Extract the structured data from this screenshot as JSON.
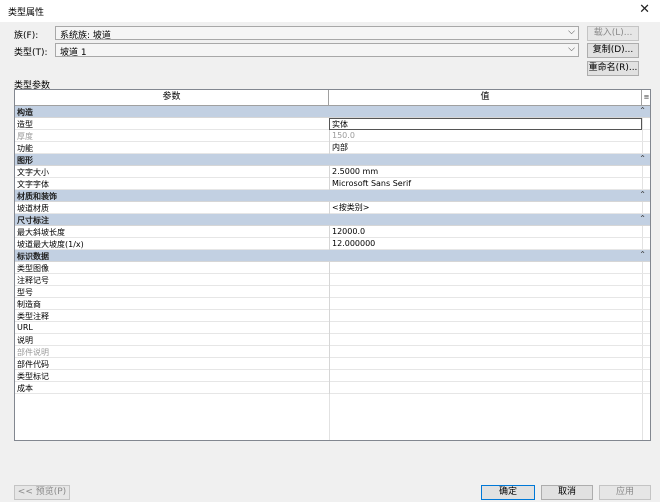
{
  "window": {
    "title": "类型属性",
    "close_glyph": "✕"
  },
  "family": {
    "label": "族(F):",
    "value": "系统族: 坡道"
  },
  "type": {
    "label": "类型(T):",
    "value": "坡道 1"
  },
  "buttons": {
    "load": "载入(L)...",
    "duplicate": "复制(D)...",
    "rename": "重命名(R)...",
    "preview": "<< 预览(P)",
    "ok": "确定",
    "cancel": "取消",
    "apply": "应用"
  },
  "section_label": "类型参数",
  "grid": {
    "headers": {
      "param": "参数",
      "value": "值",
      "toggle": "≡"
    },
    "collapse_glyph": "⌃",
    "groups": [
      {
        "name": "构造",
        "rows": [
          {
            "param": "造型",
            "value": "实体",
            "selected": true
          },
          {
            "param": "厚度",
            "value": "150.0",
            "disabled": true
          },
          {
            "param": "功能",
            "value": "内部"
          }
        ]
      },
      {
        "name": "图形",
        "rows": [
          {
            "param": "文字大小",
            "value": "2.5000 mm"
          },
          {
            "param": "文字字体",
            "value": "Microsoft Sans Serif"
          }
        ]
      },
      {
        "name": "材质和装饰",
        "rows": [
          {
            "param": "坡道材质",
            "value": "<按类别>"
          }
        ]
      },
      {
        "name": "尺寸标注",
        "rows": [
          {
            "param": "最大斜坡长度",
            "value": "12000.0"
          },
          {
            "param": "坡道最大坡度(1/x)",
            "value": "12.000000"
          }
        ]
      },
      {
        "name": "标识数据",
        "rows": [
          {
            "param": "类型图像",
            "value": ""
          },
          {
            "param": "注释记号",
            "value": ""
          },
          {
            "param": "型号",
            "value": ""
          },
          {
            "param": "制造商",
            "value": ""
          },
          {
            "param": "类型注释",
            "value": ""
          },
          {
            "param": "URL",
            "value": ""
          },
          {
            "param": "说明",
            "value": ""
          },
          {
            "param": "部件说明",
            "value": "",
            "disabled": true
          },
          {
            "param": "部件代码",
            "value": ""
          },
          {
            "param": "类型标记",
            "value": ""
          },
          {
            "param": "成本",
            "value": ""
          }
        ]
      }
    ]
  }
}
